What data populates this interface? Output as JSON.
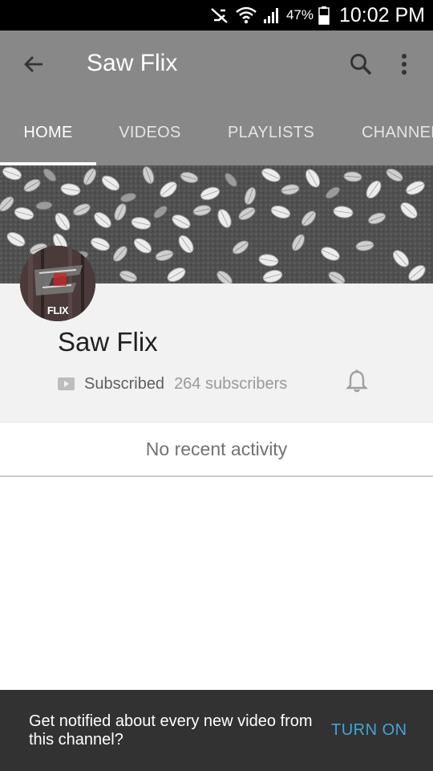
{
  "status_bar": {
    "battery_percent": "47%",
    "time": "10:02 PM",
    "icons": [
      "mute-icon",
      "wifi-icon",
      "signal-icon",
      "battery-icon"
    ]
  },
  "toolbar": {
    "title": "Saw Flix",
    "icons": [
      "back-arrow-icon",
      "search-icon",
      "more-vert-icon"
    ]
  },
  "tabs": [
    {
      "label": "HOME",
      "active": true
    },
    {
      "label": "VIDEOS",
      "active": false
    },
    {
      "label": "PLAYLISTS",
      "active": false
    },
    {
      "label": "CHANNEL",
      "active": false
    }
  ],
  "channel": {
    "avatar_text": "FLIX",
    "name": "Saw Flix",
    "subscribed_label": "Subscribed",
    "subscriber_count": "264 subscribers"
  },
  "activity": {
    "empty_text": "No recent activity"
  },
  "snackbar": {
    "message": "Get notified about every new video from this channel?",
    "action": "TURN ON"
  },
  "colors": {
    "app_bar": "#888888",
    "status_bar": "#000000",
    "snackbar_bg": "#323232",
    "snackbar_action": "#3ea6d8",
    "info_bg": "#f2f2f2"
  }
}
